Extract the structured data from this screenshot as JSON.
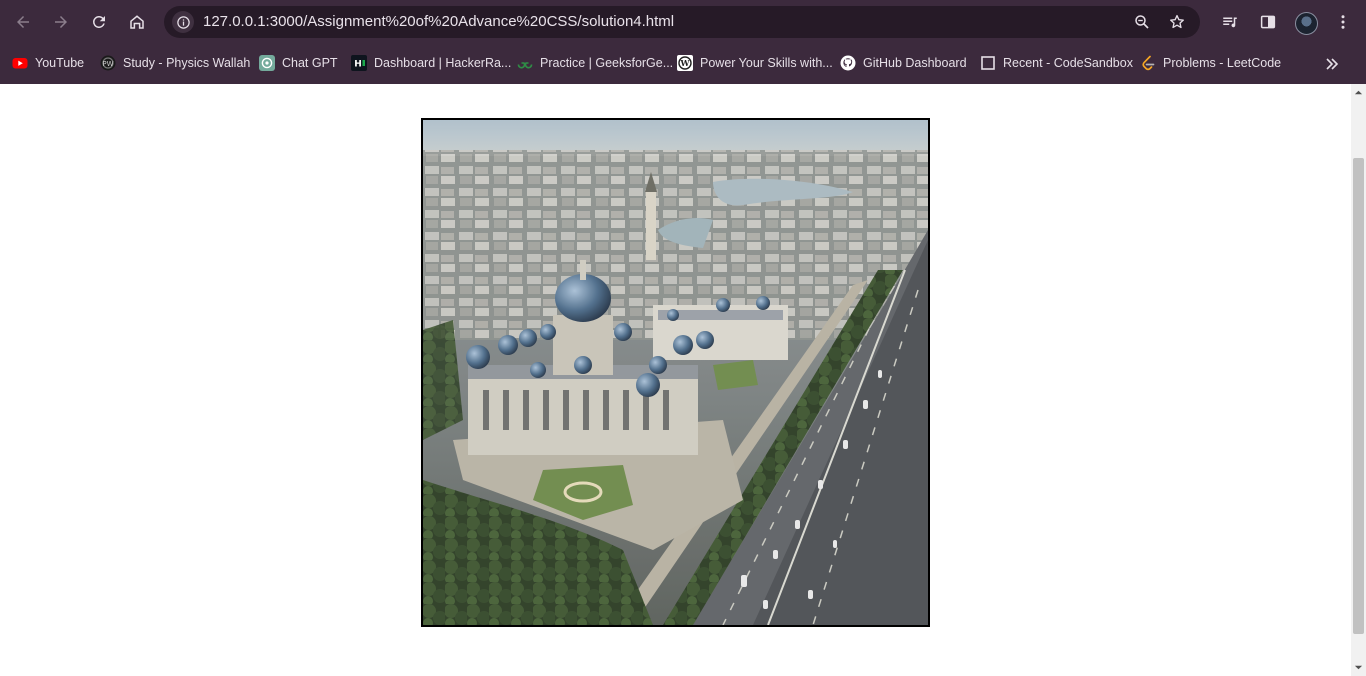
{
  "browser": {
    "url": "127.0.0.1:3000/Assignment%20of%20Advance%20CSS/solution4.html",
    "bookmarks": [
      {
        "label": "YouTube",
        "icon": "youtube-icon"
      },
      {
        "label": "Study - Physics Wallah",
        "icon": "physics-wallah-icon"
      },
      {
        "label": "Chat GPT",
        "icon": "chatgpt-icon"
      },
      {
        "label": "Dashboard | HackerRa...",
        "icon": "hackerrank-icon"
      },
      {
        "label": "Practice | GeeksforGe...",
        "icon": "geeksforgeeks-icon"
      },
      {
        "label": "Power Your Skills with...",
        "icon": "wordpress-icon"
      },
      {
        "label": "GitHub Dashboard",
        "icon": "github-icon"
      },
      {
        "label": "Recent - CodeSandbox",
        "icon": "codesandbox-icon"
      },
      {
        "label": "Problems - LeetCode",
        "icon": "leetcode-icon"
      }
    ]
  },
  "colors": {
    "chrome_bg": "#3c2a3d",
    "omnibox_bg": "#261a27",
    "page_bg": "#ffffff",
    "image_border": "#000000"
  },
  "page": {
    "image_subject": "aerial-city-cathedral-photo"
  }
}
